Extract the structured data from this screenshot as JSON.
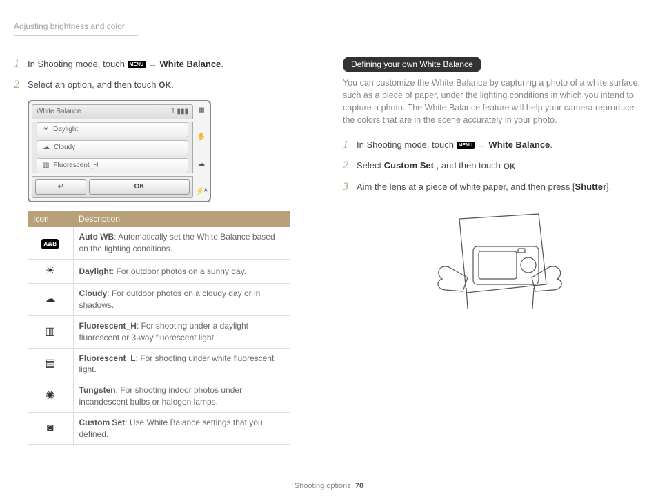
{
  "header": "Adjusting brightness and color",
  "left": {
    "step1_pre": "In Shooting mode, touch ",
    "step1_post": " → ",
    "step1_wb": "White Balance",
    "step2_pre": "Select an option, and then touch ",
    "menu_label": "MENU",
    "ok_label": "OK"
  },
  "mockup": {
    "title": "White Balance",
    "count": "1",
    "items": [
      "Daylight",
      "Cloudy",
      "Fluorescent_H"
    ],
    "back": "↩",
    "ok": "OK"
  },
  "table": {
    "h1": "Icon",
    "h2": "Description",
    "rows": [
      {
        "icon": "AWB",
        "label": "Auto WB",
        "desc": ": Automatically set the White Balance based on the lighting conditions."
      },
      {
        "icon": "☀",
        "label": "Daylight",
        "desc": ": For outdoor photos on a sunny day."
      },
      {
        "icon": "☁",
        "label": "Cloudy",
        "desc": ": For outdoor photos on a cloudy day or in shadows."
      },
      {
        "icon": "▥",
        "label": "Fluorescent_H",
        "desc": ": For shooting under a daylight fluorescent or 3-way fluorescent light."
      },
      {
        "icon": "▤",
        "label": "Fluorescent_L",
        "desc": ": For shooting under white fluorescent light."
      },
      {
        "icon": "✺",
        "label": "Tungsten",
        "desc": ": For shooting indoor photos under incandescent bulbs or halogen lamps."
      },
      {
        "icon": "◙",
        "label": "Custom Set",
        "desc": ": Use White Balance settings that you defined."
      }
    ]
  },
  "right": {
    "pill": "Defining your own White Balance",
    "body": "You can customize the White Balance by capturing a photo of a white surface, such as a piece of paper, under the lighting conditions in which you intend to capture a photo. The White Balance feature will help your camera reproduce the colors that are in the scene accurately in your photo.",
    "step1_pre": "In Shooting mode, touch ",
    "step1_post": " → ",
    "step1_wb": "White Balance",
    "step2_a": "Select ",
    "step2_b": "Custom Set",
    "step2_c": ", and then touch ",
    "step3_a": "Aim the lens at a piece of white paper, and then press [",
    "step3_b": "Shutter",
    "step3_c": "]."
  },
  "footer": {
    "section": "Shooting options",
    "page": "70"
  }
}
